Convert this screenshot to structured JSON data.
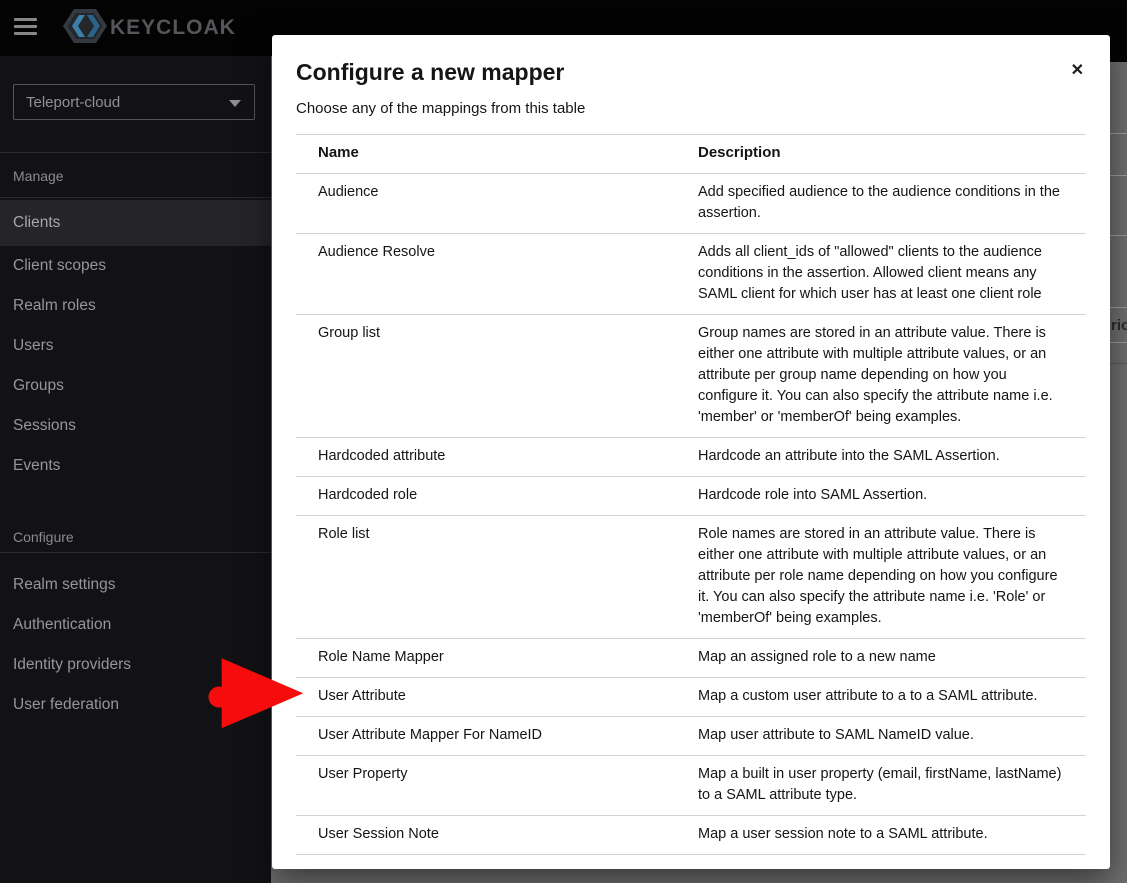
{
  "masthead": {
    "logo_text": "KEYCLOAK"
  },
  "sidebar": {
    "realm_selector": {
      "value": "Teleport-cloud"
    },
    "sections": [
      {
        "label": "Manage",
        "items": [
          {
            "label": "Clients",
            "active": true
          },
          {
            "label": "Client scopes"
          },
          {
            "label": "Realm roles"
          },
          {
            "label": "Users"
          },
          {
            "label": "Groups"
          },
          {
            "label": "Sessions"
          },
          {
            "label": "Events"
          }
        ]
      },
      {
        "label": "Configure",
        "items": [
          {
            "label": "Realm settings"
          },
          {
            "label": "Authentication"
          },
          {
            "label": "Identity providers"
          },
          {
            "label": "User federation"
          }
        ]
      }
    ]
  },
  "modal": {
    "title": "Configure a new mapper",
    "subtitle": "Choose any of the mappings from this table",
    "close_label": "✕",
    "table": {
      "columns": [
        "Name",
        "Description"
      ],
      "rows": [
        {
          "name": "Audience",
          "description": "Add specified audience to the audience conditions in the assertion."
        },
        {
          "name": "Audience Resolve",
          "description": "Adds all client_ids of \"allowed\" clients to the audience conditions in the assertion. Allowed client means any SAML client for which user has at least one client role"
        },
        {
          "name": "Group list",
          "description": "Group names are stored in an attribute value. There is either one attribute with multiple attribute values, or an attribute per group name depending on how you configure it. You can also specify the attribute name i.e. 'member' or 'memberOf' being examples."
        },
        {
          "name": "Hardcoded attribute",
          "description": "Hardcode an attribute into the SAML Assertion."
        },
        {
          "name": "Hardcoded role",
          "description": "Hardcode role into SAML Assertion."
        },
        {
          "name": "Role list",
          "description": "Role names are stored in an attribute value. There is either one attribute with multiple attribute values, or an attribute per role name depending on how you configure it. You can also specify the attribute name i.e. 'Role' or 'memberOf' being examples."
        },
        {
          "name": "Role Name Mapper",
          "description": "Map an assigned role to a new name"
        },
        {
          "name": "User Attribute",
          "description": "Map a custom user attribute to a to a SAML attribute."
        },
        {
          "name": "User Attribute Mapper For NameID",
          "description": "Map user attribute to SAML NameID value."
        },
        {
          "name": "User Property",
          "description": "Map a built in user property (email, firstName, lastName) to a SAML attribute type."
        },
        {
          "name": "User Session Note",
          "description": "Map a user session note to a SAML attribute."
        }
      ]
    }
  },
  "background": {
    "partial_text": "rio"
  },
  "annotation": {
    "arrow_color": "#f60c0c",
    "target_row": "User Attribute"
  }
}
